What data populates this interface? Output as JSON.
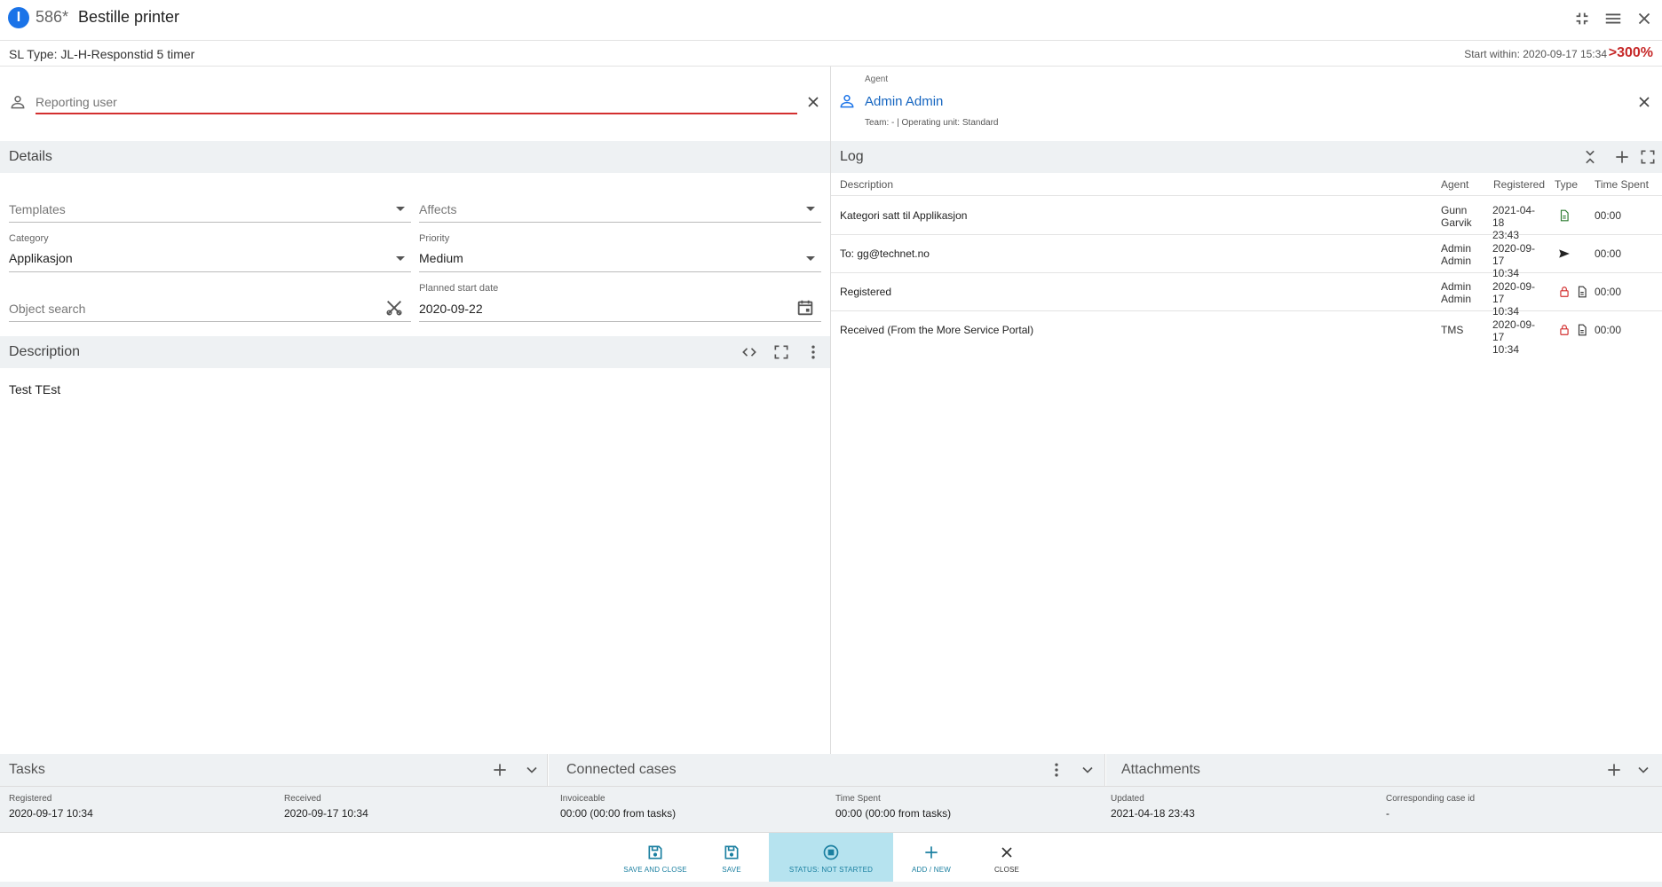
{
  "header": {
    "case_badge": "I",
    "case_number": "586*",
    "case_title": "Bestille printer"
  },
  "sl": {
    "type": "SL Type: JL-H-Responstid 5 timer",
    "start_within": "Start within: 2020-09-17 15:34",
    "overdue": ">300%"
  },
  "reporter": {
    "placeholder": "Reporting user"
  },
  "agent": {
    "label": "Agent",
    "name": "Admin Admin",
    "team_info": "Team: - | Operating unit: Standard"
  },
  "details": {
    "title": "Details",
    "templates_placeholder": "Templates",
    "affects_placeholder": "Affects",
    "category_label": "Category",
    "category_value": "Applikasjon",
    "priority_label": "Priority",
    "priority_value": "Medium",
    "object_search_placeholder": "Object search",
    "planned_start_label": "Planned start date",
    "planned_start_value": "2020-09-22"
  },
  "description": {
    "title": "Description",
    "text": "Test TEst"
  },
  "log": {
    "title": "Log",
    "columns": [
      "Description",
      "Agent",
      "Registered",
      "Type",
      "Time Spent"
    ],
    "rows": [
      {
        "description": "Kategori satt til Applikasjon",
        "agent1": "Gunn",
        "agent2": "Garvik",
        "reg1": "2021-04-18",
        "reg2": "23:43",
        "time": "00:00"
      },
      {
        "description": "To: gg@technet.no",
        "agent1": "Admin",
        "agent2": "Admin",
        "reg1": "2020-09-17",
        "reg2": "10:34",
        "time": "00:00"
      },
      {
        "description": "Registered",
        "agent1": "Admin",
        "agent2": "Admin",
        "reg1": "2020-09-17",
        "reg2": "10:34",
        "time": "00:00"
      },
      {
        "description": "Received (From the More Service Portal)",
        "agent1": "TMS",
        "agent2": "",
        "reg1": "2020-09-17",
        "reg2": "10:34",
        "time": "00:00"
      }
    ]
  },
  "bottom": {
    "tasks": "Tasks",
    "connected_cases": "Connected cases",
    "attachments": "Attachments"
  },
  "info": [
    {
      "key": "Registered",
      "value": "2020-09-17 10:34"
    },
    {
      "key": "Received",
      "value": "2020-09-17 10:34"
    },
    {
      "key": "Invoiceable",
      "value": "00:00 (00:00 from tasks)"
    },
    {
      "key": "Time Spent",
      "value": "00:00 (00:00 from tasks)"
    },
    {
      "key": "Updated",
      "value": "2021-04-18 23:43"
    },
    {
      "key": "Corresponding case id",
      "value": "-"
    }
  ],
  "footer": {
    "save_close": "SAVE AND CLOSE",
    "save": "SAVE",
    "status": "STATUS: NOT STARTED",
    "add_new": "ADD / NEW",
    "close": "CLOSE"
  },
  "colors": {
    "accent": "#1a73e8",
    "danger": "#c62828",
    "status_active": "#b6e3ef",
    "section_bg": "#eef1f3"
  }
}
